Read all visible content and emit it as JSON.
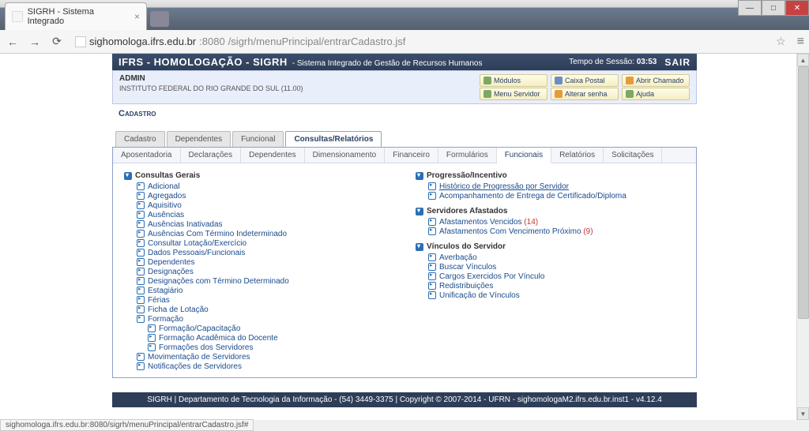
{
  "browser": {
    "tab_title": "SIGRH - Sistema Integrado",
    "url_host": "sighomologa.ifrs.edu.br",
    "url_port": ":8080",
    "url_path": "/sigrh/menuPrincipal/entrarCadastro.jsf",
    "status_text": "sighomologa.ifrs.edu.br:8080/sigrh/menuPrincipal/entrarCadastro.jsf#"
  },
  "header": {
    "title": "IFRS - HOMOLOGAÇÃO - SIGRH",
    "subtitle": "- Sistema Integrado de Gestão de Recursos Humanos",
    "session_label": "Tempo de Sessão:",
    "session_time": "03:53",
    "sair_label": "SAIR"
  },
  "user_row": {
    "name": "ADMIN",
    "org": "INSTITUTO FEDERAL DO RIO GRANDE DO SUL (11.00)"
  },
  "quick_links": {
    "modulos": "Módulos",
    "caixa_postal": "Caixa Postal",
    "abrir_chamado": "Abrir Chamado",
    "menu_servidor": "Menu Servidor",
    "alterar_senha": "Alterar senha",
    "ajuda": "Ajuda"
  },
  "breadcrumb": "Cadastro",
  "main_tabs": {
    "cadastro": "Cadastro",
    "dependentes": "Dependentes",
    "funcional": "Funcional",
    "consultas_relatorios": "Consultas/Relatórios"
  },
  "subtabs": {
    "aposentadoria": "Aposentadoria",
    "declaracoes": "Declarações",
    "dependentes": "Dependentes",
    "dimensionamento": "Dimensionamento",
    "financeiro": "Financeiro",
    "formularios": "Formulários",
    "funcionais": "Funcionais",
    "relatorios": "Relatórios",
    "solicitacoes": "Solicitações"
  },
  "left_col": {
    "consultas_gerais": "Consultas Gerais",
    "items": [
      "Adicional",
      "Agregados",
      "Aquisitivo",
      "Ausências",
      "Ausências Inativadas",
      "Ausências Com Término Indeterminado",
      "Consultar Lotação/Exercício",
      "Dados Pessoais/Funcionais",
      "Dependentes",
      "Designações",
      "Designações com Término Determinado",
      "Estagiário",
      "Férias",
      "Ficha de Lotação"
    ],
    "formacao": "Formação",
    "formacao_items": [
      "Formação/Capacitação",
      "Formação Acadêmica do Docente",
      "Formações dos Servidores"
    ],
    "movimentacao": "Movimentação de Servidores",
    "notificacoes": "Notificações de Servidores"
  },
  "right_col": {
    "progressao": "Progressão/Incentivo",
    "progressao_items": [
      "Histórico de Progressão por Servidor",
      "Acompanhamento de Entrega de Certificado/Diploma"
    ],
    "afastados": "Servidores Afastados",
    "afastados_item1": "Afastamentos Vencidos",
    "afastados_item1_count": "(14)",
    "afastados_item2": "Afastamentos Com Vencimento Próximo",
    "afastados_item2_count": "(9)",
    "vinculos": "Vínculos do Servidor",
    "vinculos_items": [
      "Averbação",
      "Buscar Vínculos",
      "Cargos Exercidos Por Vínculo",
      "Redistribuições",
      "Unificação de Vínculos"
    ]
  },
  "footer": "SIGRH | Departamento de Tecnologia da Informação - (54) 3449-3375 | Copyright © 2007-2014 - UFRN - sighomologaM2.ifrs.edu.br.inst1 - v4.12.4"
}
